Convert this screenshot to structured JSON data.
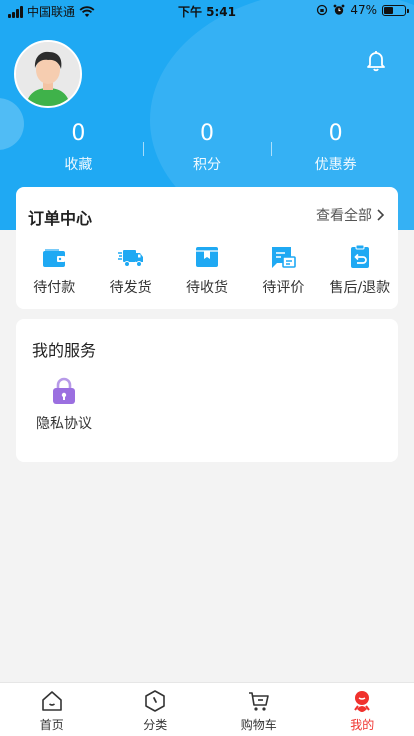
{
  "status_bar": {
    "carrier": "中国联通",
    "time": "下午 5:41",
    "battery": "47%",
    "battery_level": 0.47
  },
  "profile": {
    "avatar_icon": "user-avatar",
    "bell_icon": "bell-icon"
  },
  "stats": [
    {
      "value": "0",
      "label": "收藏"
    },
    {
      "value": "0",
      "label": "积分"
    },
    {
      "value": "0",
      "label": "优惠券"
    }
  ],
  "orders": {
    "title": "订单中心",
    "view_all": "查看全部",
    "items": [
      {
        "label": "待付款",
        "icon": "wallet-icon"
      },
      {
        "label": "待发货",
        "icon": "truck-icon"
      },
      {
        "label": "待收货",
        "icon": "box-icon"
      },
      {
        "label": "待评价",
        "icon": "comment-icon"
      },
      {
        "label": "售后/退款",
        "icon": "refund-icon"
      }
    ]
  },
  "services": {
    "title": "我的服务",
    "items": [
      {
        "label": "隐私协议",
        "icon": "lock-icon"
      }
    ]
  },
  "tabs": [
    {
      "label": "首页",
      "icon": "home-icon"
    },
    {
      "label": "分类",
      "icon": "category-icon"
    },
    {
      "label": "购物车",
      "icon": "cart-icon"
    },
    {
      "label": "我的",
      "icon": "profile-icon",
      "active": true
    }
  ],
  "colors": {
    "header": "#1fa9f3",
    "icon_blue": "#1fa9f3",
    "lock_purple": "#9b6fe0",
    "tab_active": "#f0312d"
  }
}
